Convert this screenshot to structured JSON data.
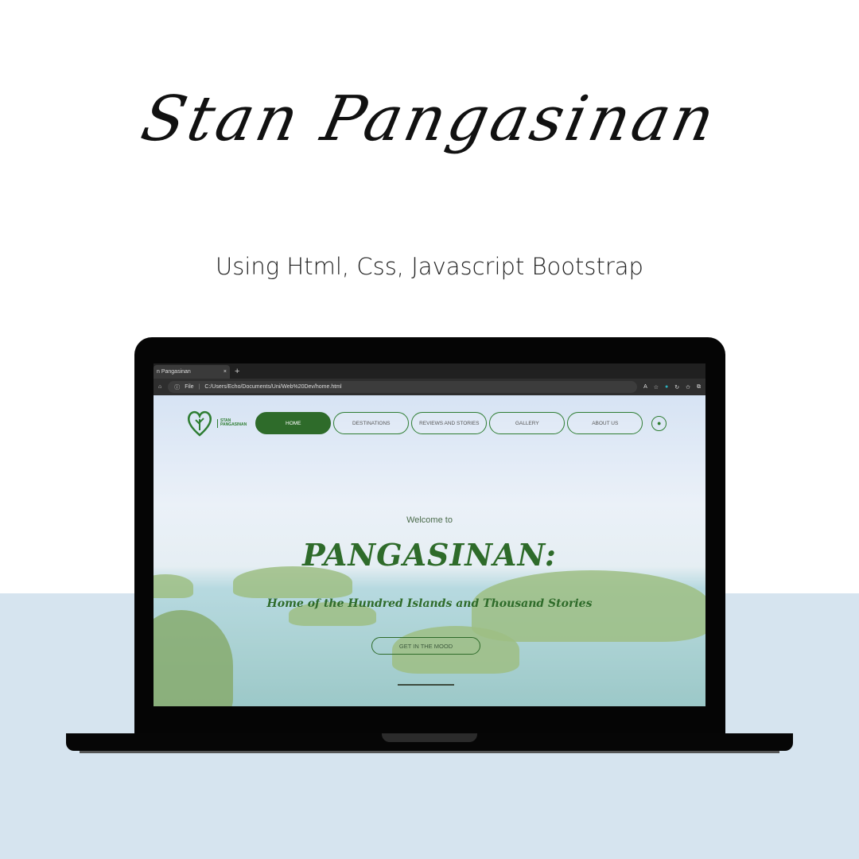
{
  "poster": {
    "title": "Stan Pangasinan",
    "subtitle": "Using Html, Css, Javascript Bootstrap"
  },
  "browser": {
    "tab_title": "n Pangasinan",
    "tab_close": "×",
    "new_tab": "+",
    "url_label": "File",
    "url": "C:/Users/Echo/Documents/Uni/Web%20Dev/home.html"
  },
  "site": {
    "logo_text_1": "STAN",
    "logo_text_2": "PANGASINAN",
    "nav": [
      {
        "label": "HOME",
        "active": true
      },
      {
        "label": "DESTINATIONS"
      },
      {
        "label": "REVIEWS AND STORIES"
      },
      {
        "label": "GALLERY"
      },
      {
        "label": "ABOUT US"
      }
    ],
    "welcome": "Welcome to",
    "hero_title": "PANGASINAN:",
    "tagline": "Home of the Hundred Islands and Thousand Stories",
    "cta": "GET IN THE MOOD",
    "accent": "#2e6b2a"
  }
}
